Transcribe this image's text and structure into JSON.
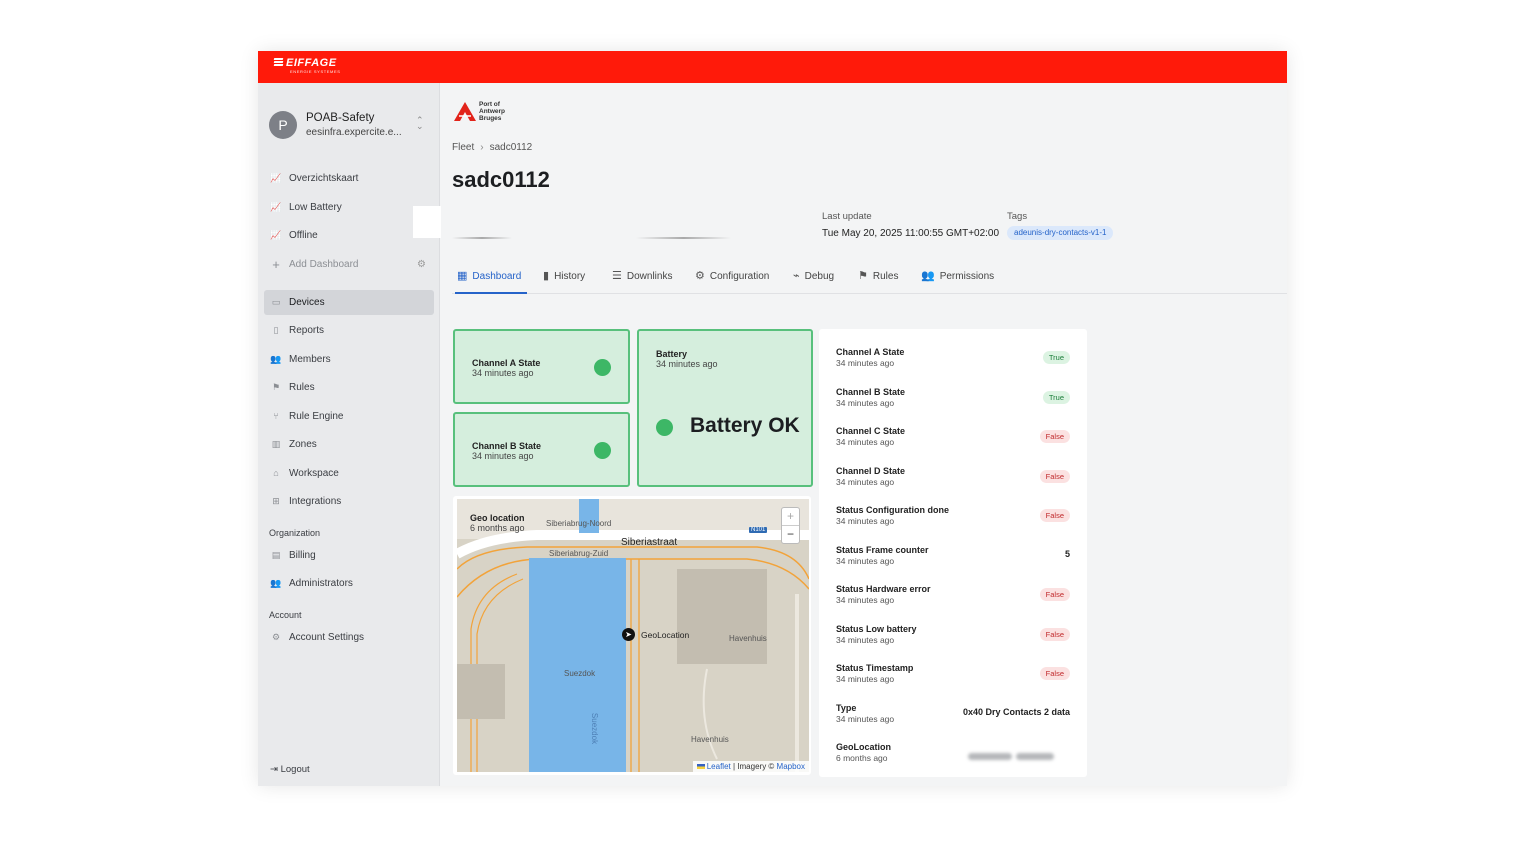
{
  "brand": {
    "name": "EIFFAGE",
    "sub": "ENERGIE SYSTEMES"
  },
  "org": {
    "initial": "P",
    "name": "POAB-Safety",
    "sub": "eesinfra.expercite.e..."
  },
  "sidebar": {
    "dashboards": [
      {
        "label": "Overzichtskaart",
        "icon": "chart-icon"
      },
      {
        "label": "Low Battery",
        "icon": "chart-icon"
      },
      {
        "label": "Offline",
        "icon": "chart-icon"
      },
      {
        "label": "Add Dashboard",
        "icon": "plus-icon"
      }
    ],
    "main": [
      {
        "label": "Devices",
        "icon": "devices-icon",
        "active": true
      },
      {
        "label": "Reports",
        "icon": "file-icon"
      },
      {
        "label": "Members",
        "icon": "users-icon"
      },
      {
        "label": "Rules",
        "icon": "rules-icon"
      },
      {
        "label": "Rule Engine",
        "icon": "branch-icon"
      },
      {
        "label": "Zones",
        "icon": "map-icon"
      },
      {
        "label": "Workspace",
        "icon": "home-icon"
      },
      {
        "label": "Integrations",
        "icon": "grid-icon"
      }
    ],
    "organization_label": "Organization",
    "organization": [
      {
        "label": "Billing",
        "icon": "billing-icon"
      },
      {
        "label": "Administrators",
        "icon": "users-icon"
      }
    ],
    "account_label": "Account",
    "account": [
      {
        "label": "Account Settings",
        "icon": "gear-icon"
      }
    ],
    "logout": "Logout"
  },
  "main": {
    "client_logo": "Port of Antwerp Bruges",
    "client_logo_lines": [
      "Port of",
      "Antwerp",
      "Bruges"
    ],
    "breadcrumb": {
      "root": "Fleet",
      "current": "sadc0112"
    },
    "title": "sadc0112",
    "last_update_label": "Last update",
    "last_update_value": "Tue May 20, 2025 11:00:55 GMT+02:00",
    "tags_label": "Tags",
    "tag": "adeunis-dry-contacts-v1-1",
    "tabs": [
      {
        "label": "Dashboard",
        "icon": "table-icon",
        "active": true
      },
      {
        "label": "History",
        "icon": "bar-chart-icon"
      },
      {
        "label": "Downlinks",
        "icon": "sliders-icon"
      },
      {
        "label": "Configuration",
        "icon": "gear-icon"
      },
      {
        "label": "Debug",
        "icon": "rss-icon"
      },
      {
        "label": "Rules",
        "icon": "rules-icon"
      },
      {
        "label": "Permissions",
        "icon": "users-icon"
      }
    ]
  },
  "cards": {
    "channel_a": {
      "title": "Channel A State",
      "time": "34 minutes ago",
      "color": "#3db766"
    },
    "channel_b": {
      "title": "Channel B State",
      "time": "34 minutes ago",
      "color": "#3db766"
    },
    "battery": {
      "title": "Battery",
      "time": "34 minutes ago",
      "status": "Battery OK"
    }
  },
  "map": {
    "title": "Geo location",
    "time": "6 months ago",
    "street": "Siberiastraat",
    "labels": [
      "Siberiabrug-Noord",
      "Siberiabrug-Zuid",
      "Suezdok",
      "Havenhuis",
      "Havenhuis",
      "Suezdok"
    ],
    "road_shield": "N101",
    "pin_label": "GeoLocation",
    "zoom_in": "+",
    "zoom_out": "−",
    "attribution": {
      "leaflet": "Leaflet",
      "imagery": " | Imagery © ",
      "mapbox": "Mapbox"
    }
  },
  "properties": [
    {
      "name": "Channel A State",
      "time": "34 minutes ago",
      "badge": "True",
      "kind": "true"
    },
    {
      "name": "Channel B State",
      "time": "34 minutes ago",
      "badge": "True",
      "kind": "true"
    },
    {
      "name": "Channel C State",
      "time": "34 minutes ago",
      "badge": "False",
      "kind": "false"
    },
    {
      "name": "Channel D State",
      "time": "34 minutes ago",
      "badge": "False",
      "kind": "false"
    },
    {
      "name": "Status Configuration done",
      "time": "34 minutes ago",
      "badge": "False",
      "kind": "false"
    },
    {
      "name": "Status Frame counter",
      "time": "34 minutes ago",
      "value": "5"
    },
    {
      "name": "Status Hardware error",
      "time": "34 minutes ago",
      "badge": "False",
      "kind": "false"
    },
    {
      "name": "Status Low battery",
      "time": "34 minutes ago",
      "badge": "False",
      "kind": "false"
    },
    {
      "name": "Status Timestamp",
      "time": "34 minutes ago",
      "badge": "False",
      "kind": "false"
    },
    {
      "name": "Type",
      "time": "34 minutes ago",
      "value": "0x40 Dry Contacts 2 data"
    },
    {
      "name": "GeoLocation",
      "time": "6 months ago",
      "blurred": true
    }
  ],
  "colors": {
    "topbar": "#ff1a0a",
    "accent": "#2563c9",
    "ok": "#3db766"
  }
}
